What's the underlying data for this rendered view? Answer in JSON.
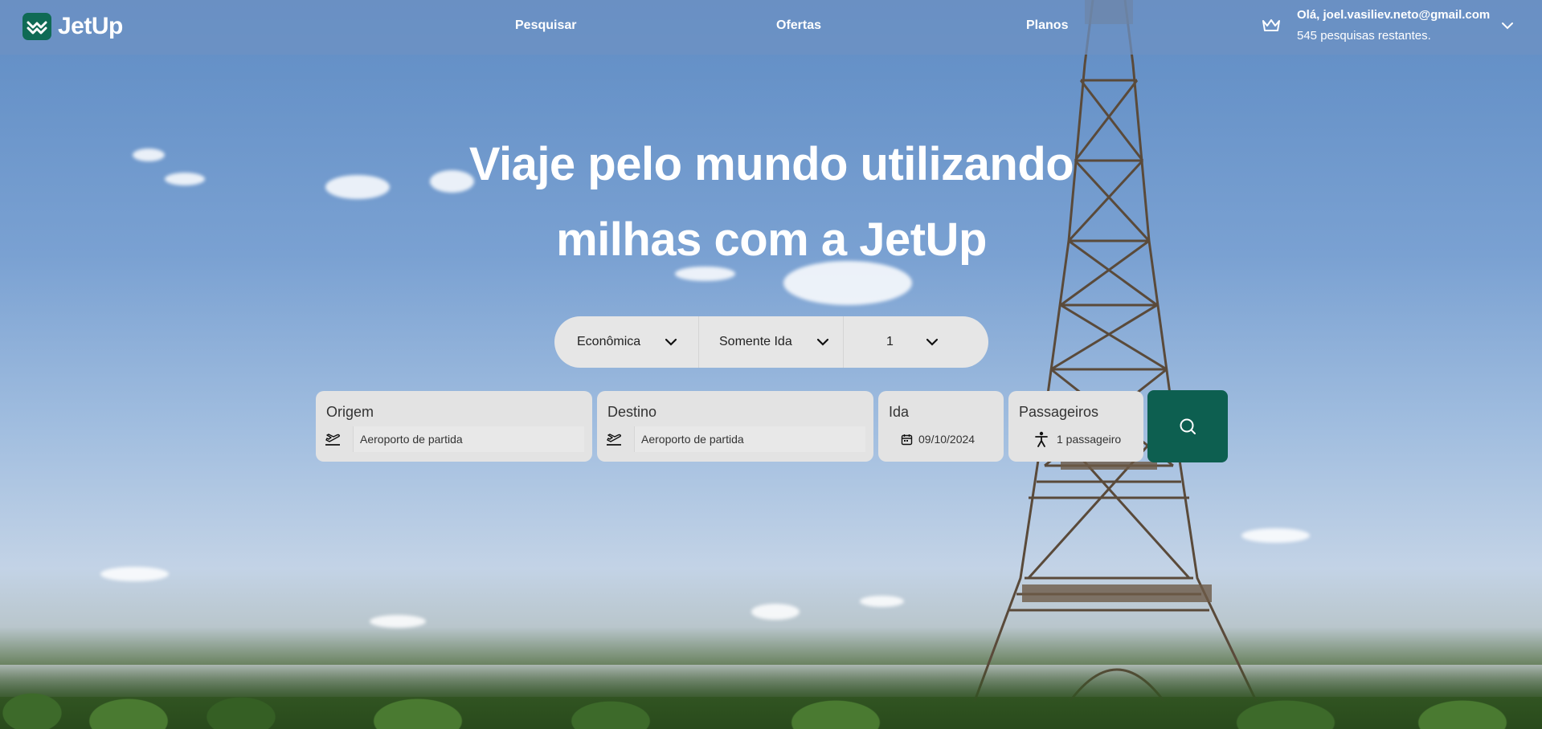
{
  "brand": {
    "name": "JetUp",
    "accent": "#0f6a55"
  },
  "nav": {
    "items": [
      {
        "label": "Pesquisar"
      },
      {
        "label": "Ofertas"
      },
      {
        "label": "Planos"
      }
    ]
  },
  "user": {
    "greeting": "Olá, joel.vasiliev.neto@gmail.com",
    "remaining": "545 pesquisas restantes."
  },
  "hero": {
    "line1": "Viaje pelo mundo utilizando",
    "line2": "milhas com a JetUp"
  },
  "options": {
    "cabin": "Econômica",
    "trip_type": "Somente Ida",
    "count": "1"
  },
  "fields": {
    "origin": {
      "label": "Origem",
      "placeholder": "Aeroporto de partida"
    },
    "destination": {
      "label": "Destino",
      "placeholder": "Aeroporto de partida"
    },
    "date": {
      "label": "Ida",
      "value": "09/10/2024"
    },
    "passengers": {
      "label": "Passageiros",
      "value": "1 passageiro"
    }
  },
  "search_button": {
    "icon": "search-icon",
    "color": "#0d5f50"
  }
}
